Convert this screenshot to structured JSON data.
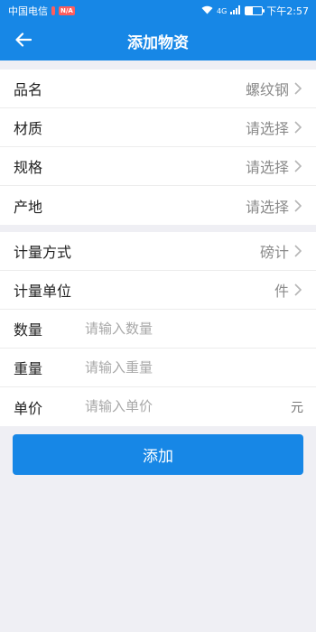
{
  "status_bar": {
    "carrier": "中国电信",
    "badge1": "",
    "badge2": "N/A",
    "network": "4G",
    "time": "下午2:57",
    "battery_level": 0.45
  },
  "header": {
    "title": "添加物资",
    "back_icon": "arrow-left-icon",
    "bg_color": "#1787e6"
  },
  "basic_info": [
    {
      "label": "品名",
      "value": "螺纹钢"
    },
    {
      "label": "材质",
      "value": "请选择"
    },
    {
      "label": "规格",
      "value": "请选择"
    },
    {
      "label": "产地",
      "value": "请选择"
    }
  ],
  "measure": {
    "method": {
      "label": "计量方式",
      "value": "磅计"
    },
    "unit": {
      "label": "计量单位",
      "value": "件"
    },
    "quantity": {
      "label": "数量",
      "placeholder": "请输入数量"
    },
    "weight": {
      "label": "重量",
      "placeholder": "请输入重量"
    },
    "price": {
      "label": "单价",
      "placeholder": "请输入单价",
      "unit": "元"
    }
  },
  "submit_label": "添加"
}
